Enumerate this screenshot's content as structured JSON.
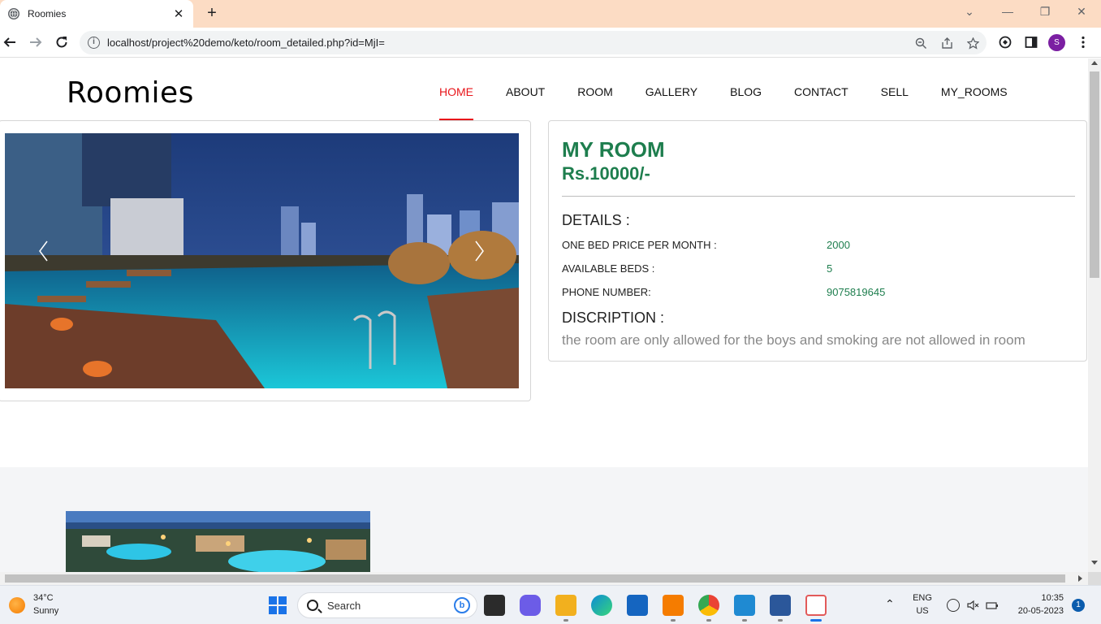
{
  "browser": {
    "tab_title": "Roomies",
    "tab_close": "✕",
    "new_tab": "+",
    "url": "localhost/project%20demo/keto/room_detailed.php?id=MjI=",
    "profile_initial": "S",
    "tabbar_color": "#fcdcc4"
  },
  "site": {
    "brand": "Roomies",
    "nav": [
      "HOME",
      "ABOUT",
      "ROOM",
      "GALLERY",
      "BLOG",
      "CONTACT",
      "SELL",
      "MY_ROOMS"
    ],
    "active_nav": "HOME",
    "accent_color": "#e8161b"
  },
  "room": {
    "title": "MY ROOM",
    "price": "Rs.10000/-",
    "details_heading": "DETAILS :",
    "details": [
      {
        "label": "ONE BED PRICE PER MONTH :",
        "value": "2000"
      },
      {
        "label": "AVAILABLE BEDS :",
        "value": "5"
      },
      {
        "label": "PHONE NUMBER:",
        "value": "9075819645"
      }
    ],
    "description_heading": "DISCRIPTION :",
    "description": "the room are only allowed for the boys and smoking are not allowed in room",
    "text_color": "#1e7e4e"
  },
  "taskbar": {
    "temperature": "34°C",
    "weather": "Sunny",
    "search_placeholder": "Search",
    "language": "ENG",
    "region": "US",
    "time": "10:35",
    "date": "20-05-2023",
    "notifications": "1"
  }
}
